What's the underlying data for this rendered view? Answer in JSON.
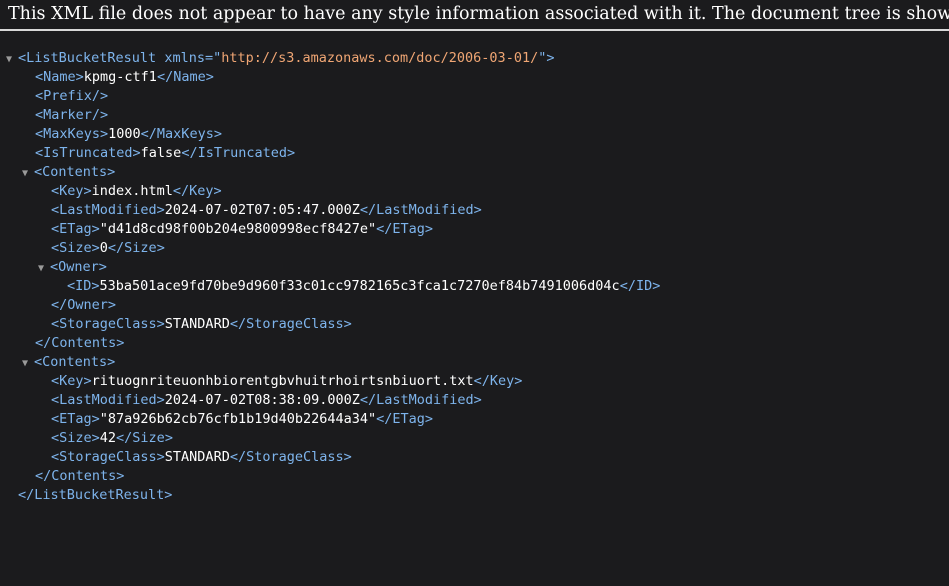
{
  "info_bar": {
    "text": "This XML file does not appear to have any style information associated with it. The document tree is shown below."
  },
  "tree": {
    "root_open": "<ListBucketResult",
    "root_attr_name": "xmlns",
    "root_attr_eq": "=\"",
    "root_attr_value": "http://s3.amazonaws.com/doc/2006-03-01/",
    "root_attr_close": "\">",
    "root_close": "</ListBucketResult>",
    "name_open": "<Name>",
    "name_value": "kpmg-ctf1",
    "name_close": "</Name>",
    "prefix": "<Prefix/>",
    "marker": "<Marker/>",
    "maxkeys_open": "<MaxKeys>",
    "maxkeys_value": "1000",
    "maxkeys_close": "</MaxKeys>",
    "istruncated_open": "<IsTruncated>",
    "istruncated_value": "false",
    "istruncated_close": "</IsTruncated>",
    "contents": [
      {
        "open": "<Contents>",
        "close": "</Contents>",
        "key_open": "<Key>",
        "key": "index.html",
        "key_close": "</Key>",
        "lm_open": "<LastModified>",
        "last_modified": "2024-07-02T07:05:47.000Z",
        "lm_close": "</LastModified>",
        "etag_open": "<ETag>",
        "etag": "\"d41d8cd98f00b204e9800998ecf8427e\"",
        "etag_close": "</ETag>",
        "size_open": "<Size>",
        "size": "0",
        "size_close": "</Size>",
        "owner_open": "<Owner>",
        "owner_close": "</Owner>",
        "id_open": "<ID>",
        "owner_id": "53ba501ace9fd70be9d960f33c01cc9782165c3fca1c7270ef84b7491006d04c",
        "id_close": "</ID>",
        "sc_open": "<StorageClass>",
        "storage_class": "STANDARD",
        "sc_close": "</StorageClass>"
      },
      {
        "open": "<Contents>",
        "close": "</Contents>",
        "key_open": "<Key>",
        "key": "rituognriteuonhbiorentgbvhuitrhoirtsnbiuort.txt",
        "key_close": "</Key>",
        "lm_open": "<LastModified>",
        "last_modified": "2024-07-02T08:38:09.000Z",
        "lm_close": "</LastModified>",
        "etag_open": "<ETag>",
        "etag": "\"87a926b62cb76cfb1b19d40b22644a34\"",
        "etag_close": "</ETag>",
        "size_open": "<Size>",
        "size": "42",
        "size_close": "</Size>",
        "sc_open": "<StorageClass>",
        "storage_class": "STANDARD",
        "sc_close": "</StorageClass>"
      }
    ]
  },
  "icons": {
    "expanded": "▼"
  }
}
